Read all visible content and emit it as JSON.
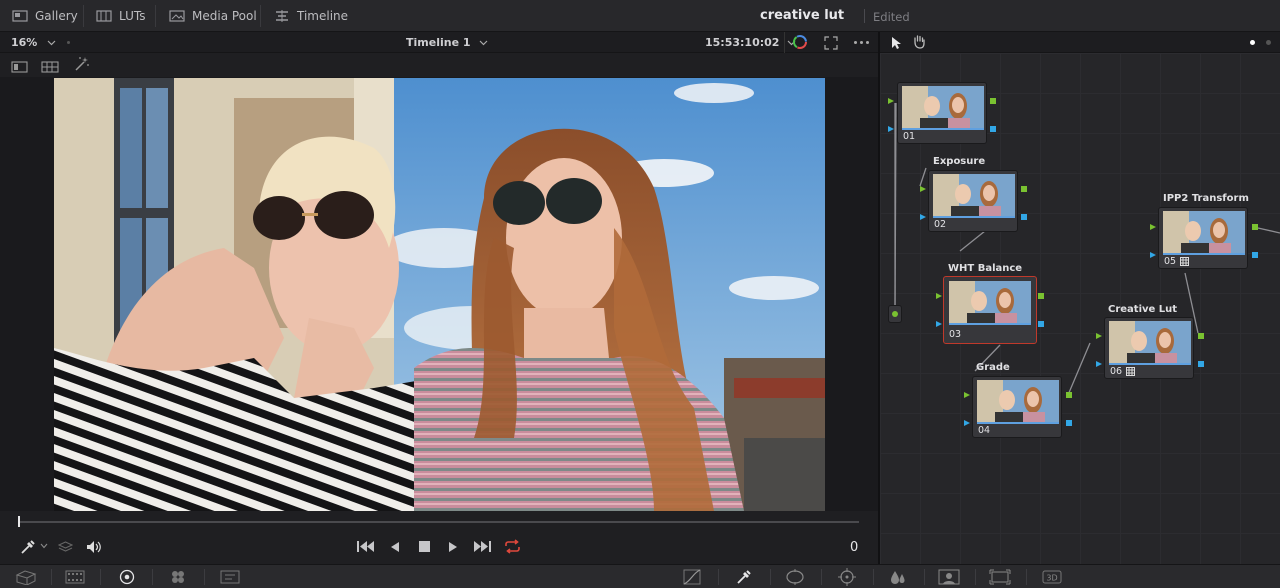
{
  "topbar": {
    "tabs": [
      {
        "label": "Gallery",
        "icon": "gallery-icon"
      },
      {
        "label": "LUTs",
        "icon": "luts-icon"
      },
      {
        "label": "Media Pool",
        "icon": "media-pool-icon"
      },
      {
        "label": "Timeline",
        "icon": "timeline-icon"
      }
    ],
    "project_title": "creative lut",
    "status": "Edited"
  },
  "viewer": {
    "zoom": "16%",
    "timeline_name": "Timeline 1",
    "timecode": "15:53:10:02"
  },
  "nodes": [
    {
      "id": "01",
      "label": "",
      "lut": false
    },
    {
      "id": "02",
      "label": "Exposure",
      "lut": false
    },
    {
      "id": "03",
      "label": "WHT Balance",
      "lut": false,
      "selected": true
    },
    {
      "id": "04",
      "label": "Grade",
      "lut": false
    },
    {
      "id": "05",
      "label": "IPP2 Transform",
      "lut": true
    },
    {
      "id": "06",
      "label": "Creative Lut",
      "lut": true
    }
  ],
  "transport": {
    "frame_counter": "0",
    "loop_color": "#e0483c"
  },
  "colors": {
    "accent_blue": "#32a7e6",
    "accent_green": "#7ac231",
    "selection_red": "#c0392b"
  }
}
